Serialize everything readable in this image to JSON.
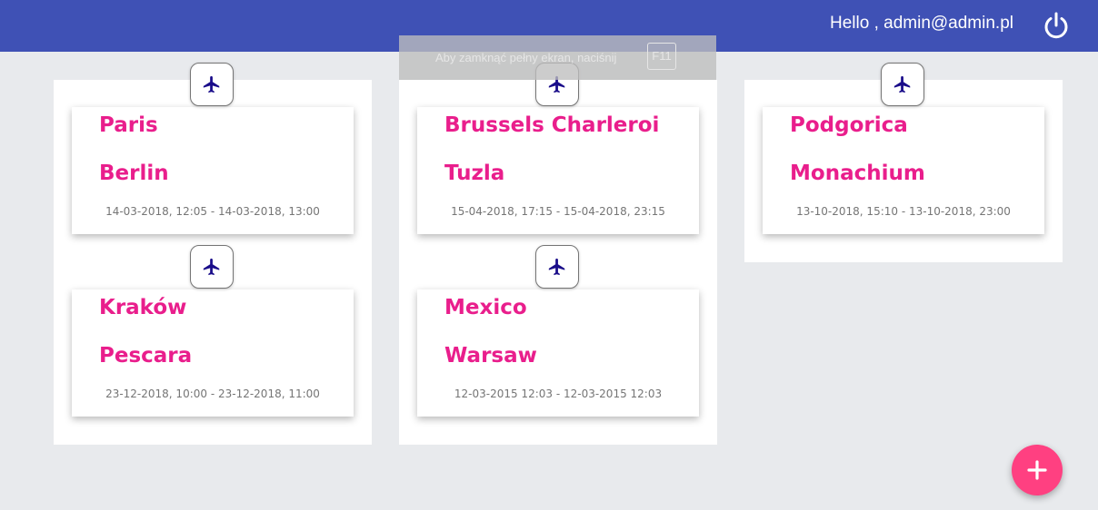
{
  "header": {
    "greeting": "Hello , admin@admin.pl",
    "logout_icon": "power-icon"
  },
  "fullscreen_notice": {
    "text": "Aby zamknąć pełny ekran, naciśnij",
    "key": "F11"
  },
  "flights": [
    {
      "from": "Paris",
      "to": "Berlin",
      "time": "14-03-2018, 12:05 - 14-03-2018, 13:00",
      "icon": "airplane-icon"
    },
    {
      "from": "Kraków",
      "to": "Pescara",
      "time": "23-12-2018, 10:00 - 23-12-2018, 11:00",
      "icon": "airplane-icon"
    },
    {
      "from": "Brussels Charleroi",
      "to": "Tuzla",
      "time": "15-04-2018, 17:15 - 15-04-2018, 23:15",
      "icon": "airplane-icon"
    },
    {
      "from": "Mexico",
      "to": "Warsaw",
      "time": "12-03-2015 12:03 - 12-03-2015 12:03",
      "icon": "airplane-icon"
    },
    {
      "from": "Podgorica",
      "to": "Monachium",
      "time": "13-10-2018, 15:10 - 13-10-2018, 23:00",
      "icon": "airplane-icon"
    }
  ],
  "fab": {
    "icon": "plus-icon"
  },
  "colors": {
    "header": "#3f51b5",
    "city": "#e91e8c",
    "plane": "#1a0d8a",
    "fab": "#ff4081",
    "background": "#e8eaed"
  }
}
